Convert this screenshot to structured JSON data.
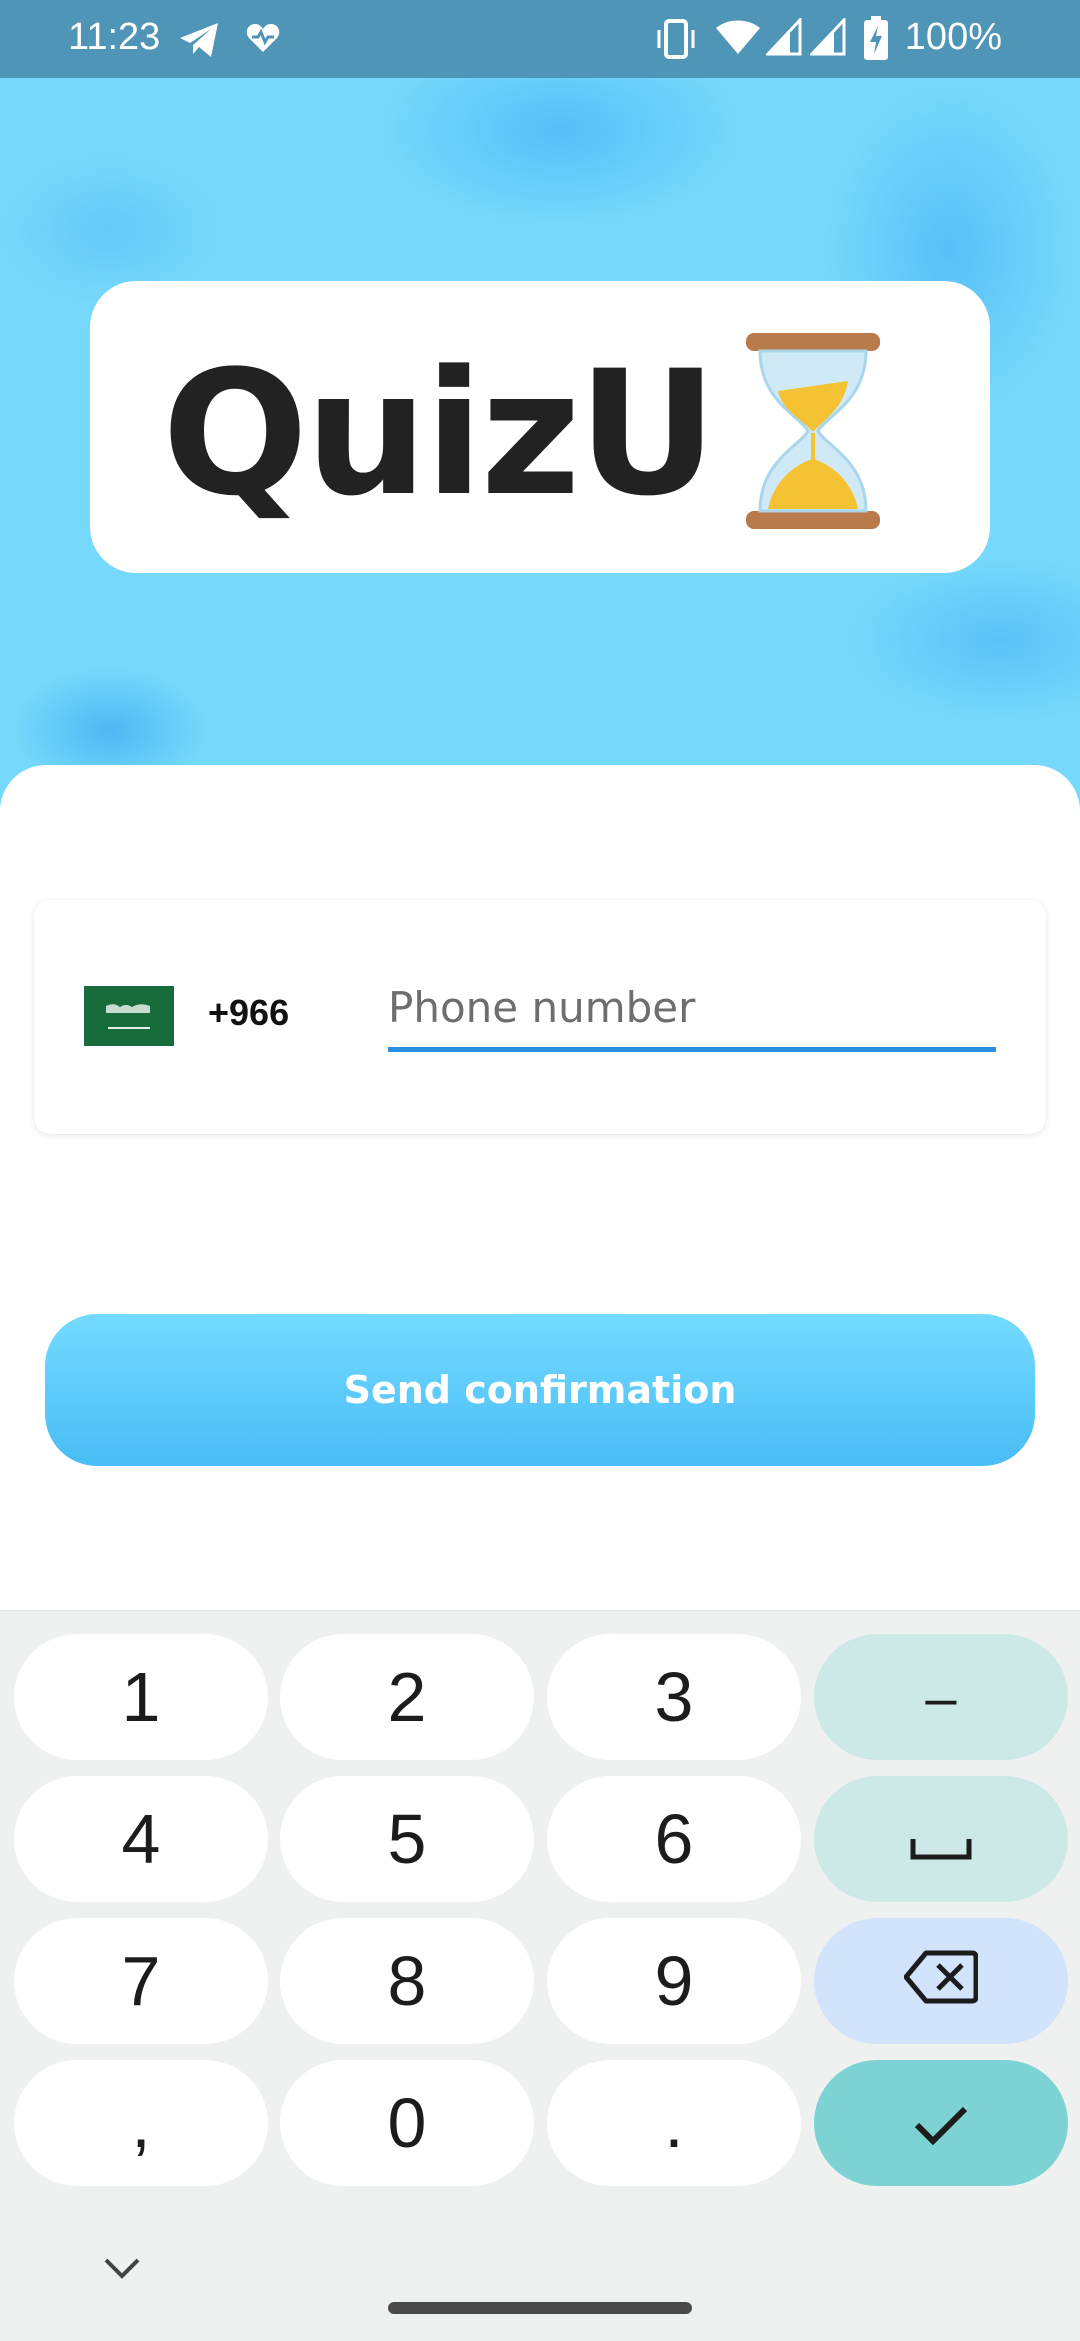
{
  "status_bar": {
    "time": "11:23",
    "battery_text": "100%",
    "icons": [
      "telegram-icon",
      "heart-pulse-icon",
      "vibrate-icon",
      "wifi-icon",
      "signal-icon",
      "signal-icon",
      "battery-charging-icon"
    ]
  },
  "logo": {
    "text": "QuizU",
    "emoji_icon": "hourglass-icon"
  },
  "phone": {
    "country_flag": "saudi-arabia-flag",
    "dial_code": "+966",
    "placeholder": "Phone number",
    "value": ""
  },
  "actions": {
    "send_label": "Send confirmation"
  },
  "keyboard": {
    "keys": [
      "1",
      "2",
      "3",
      "–",
      "4",
      "5",
      "6",
      "␣",
      "7",
      "8",
      "9",
      "⌫",
      ",",
      "0",
      ".",
      "✓"
    ]
  },
  "colors": {
    "accent": "#49bdf6",
    "input_underline": "#2b8fe0",
    "status_bar": "#4f95b8",
    "flag_green": "#166c3b"
  }
}
